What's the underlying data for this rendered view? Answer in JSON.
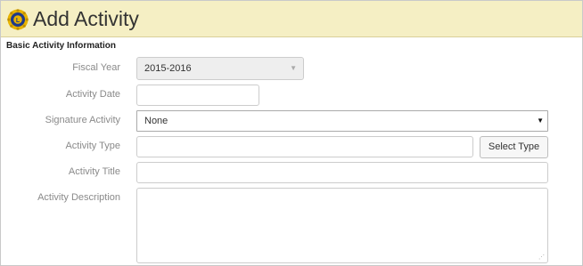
{
  "header": {
    "title": "Add Activity",
    "logo_icon": "lions-club-logo-icon"
  },
  "form": {
    "section_title": "Basic Activity Information",
    "fiscal_year": {
      "label": "Fiscal Year",
      "value": "2015-2016"
    },
    "activity_date": {
      "label": "Activity Date",
      "value": ""
    },
    "signature_activity": {
      "label": "Signature Activity",
      "value": "None"
    },
    "activity_type": {
      "label": "Activity Type",
      "value": "",
      "button_label": "Select Type"
    },
    "activity_title": {
      "label": "Activity Title",
      "value": ""
    },
    "activity_description": {
      "label": "Activity Description",
      "value": ""
    }
  },
  "colors": {
    "header_bg": "#f5efc4",
    "label_text": "#8a8a8a",
    "logo_blue": "#1f3a8a",
    "logo_gold": "#e8b400"
  }
}
